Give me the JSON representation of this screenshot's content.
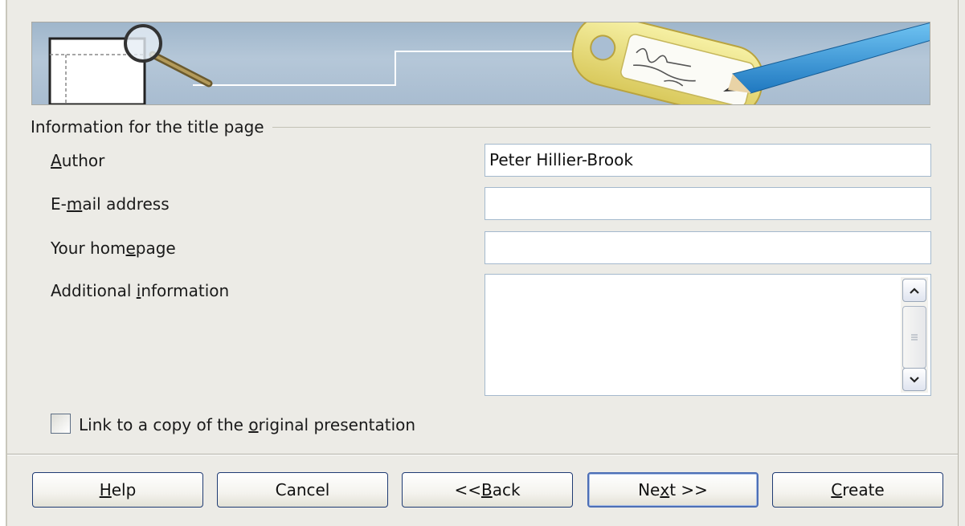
{
  "title_section": {
    "group_label": "Information for the title page"
  },
  "fields": {
    "author": {
      "label_pre": "",
      "label_key": "A",
      "label_post": "uthor",
      "value": "Peter Hillier-Brook"
    },
    "email": {
      "label_pre": "E-",
      "label_key": "m",
      "label_post": "ail address",
      "value": ""
    },
    "homepage": {
      "label_pre": "Your hom",
      "label_key": "e",
      "label_post": "page",
      "value": ""
    },
    "additional": {
      "label_pre": "Additional ",
      "label_key": "i",
      "label_post": "nformation",
      "value": ""
    }
  },
  "checkbox": {
    "label_pre": "Link to a copy of the ",
    "label_key": "o",
    "label_post": "riginal presentation",
    "checked": false
  },
  "buttons": {
    "help": {
      "pre": "",
      "key": "H",
      "post": "elp"
    },
    "cancel": {
      "pre": "Cancel",
      "key": "",
      "post": ""
    },
    "back": {
      "pre": "<< ",
      "key": "B",
      "post": "ack"
    },
    "next": {
      "pre": "Ne",
      "key": "x",
      "post": "t >>"
    },
    "create": {
      "pre": "",
      "key": "C",
      "post": "reate"
    }
  },
  "colors": {
    "dialog_bg": "#ecebe6",
    "field_border": "#a4b9cd",
    "button_border": "#1f3b73",
    "default_button_border": "#4d6fb6"
  }
}
